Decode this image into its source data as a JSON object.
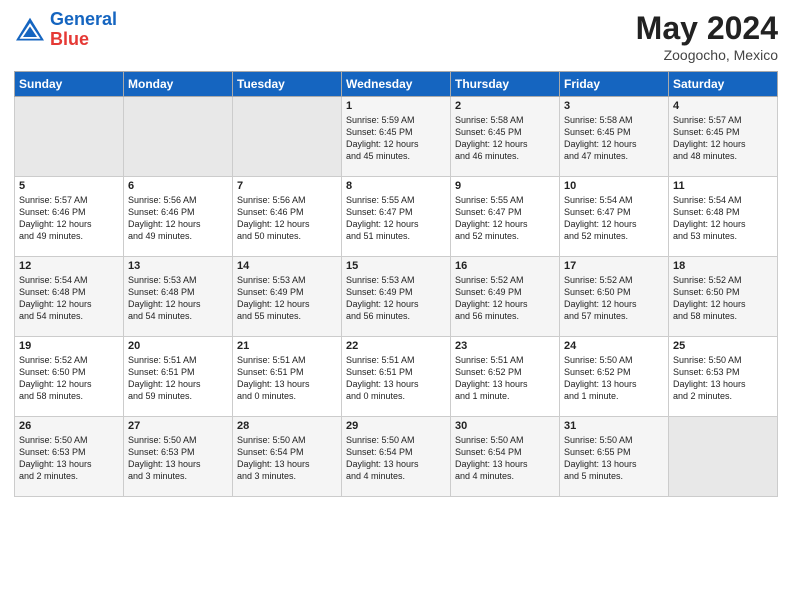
{
  "header": {
    "logo_line1": "General",
    "logo_line2": "Blue",
    "month": "May 2024",
    "location": "Zoogocho, Mexico"
  },
  "weekdays": [
    "Sunday",
    "Monday",
    "Tuesday",
    "Wednesday",
    "Thursday",
    "Friday",
    "Saturday"
  ],
  "weeks": [
    [
      {
        "day": "",
        "info": ""
      },
      {
        "day": "",
        "info": ""
      },
      {
        "day": "",
        "info": ""
      },
      {
        "day": "1",
        "info": "Sunrise: 5:59 AM\nSunset: 6:45 PM\nDaylight: 12 hours\nand 45 minutes."
      },
      {
        "day": "2",
        "info": "Sunrise: 5:58 AM\nSunset: 6:45 PM\nDaylight: 12 hours\nand 46 minutes."
      },
      {
        "day": "3",
        "info": "Sunrise: 5:58 AM\nSunset: 6:45 PM\nDaylight: 12 hours\nand 47 minutes."
      },
      {
        "day": "4",
        "info": "Sunrise: 5:57 AM\nSunset: 6:45 PM\nDaylight: 12 hours\nand 48 minutes."
      }
    ],
    [
      {
        "day": "5",
        "info": "Sunrise: 5:57 AM\nSunset: 6:46 PM\nDaylight: 12 hours\nand 49 minutes."
      },
      {
        "day": "6",
        "info": "Sunrise: 5:56 AM\nSunset: 6:46 PM\nDaylight: 12 hours\nand 49 minutes."
      },
      {
        "day": "7",
        "info": "Sunrise: 5:56 AM\nSunset: 6:46 PM\nDaylight: 12 hours\nand 50 minutes."
      },
      {
        "day": "8",
        "info": "Sunrise: 5:55 AM\nSunset: 6:47 PM\nDaylight: 12 hours\nand 51 minutes."
      },
      {
        "day": "9",
        "info": "Sunrise: 5:55 AM\nSunset: 6:47 PM\nDaylight: 12 hours\nand 52 minutes."
      },
      {
        "day": "10",
        "info": "Sunrise: 5:54 AM\nSunset: 6:47 PM\nDaylight: 12 hours\nand 52 minutes."
      },
      {
        "day": "11",
        "info": "Sunrise: 5:54 AM\nSunset: 6:48 PM\nDaylight: 12 hours\nand 53 minutes."
      }
    ],
    [
      {
        "day": "12",
        "info": "Sunrise: 5:54 AM\nSunset: 6:48 PM\nDaylight: 12 hours\nand 54 minutes."
      },
      {
        "day": "13",
        "info": "Sunrise: 5:53 AM\nSunset: 6:48 PM\nDaylight: 12 hours\nand 54 minutes."
      },
      {
        "day": "14",
        "info": "Sunrise: 5:53 AM\nSunset: 6:49 PM\nDaylight: 12 hours\nand 55 minutes."
      },
      {
        "day": "15",
        "info": "Sunrise: 5:53 AM\nSunset: 6:49 PM\nDaylight: 12 hours\nand 56 minutes."
      },
      {
        "day": "16",
        "info": "Sunrise: 5:52 AM\nSunset: 6:49 PM\nDaylight: 12 hours\nand 56 minutes."
      },
      {
        "day": "17",
        "info": "Sunrise: 5:52 AM\nSunset: 6:50 PM\nDaylight: 12 hours\nand 57 minutes."
      },
      {
        "day": "18",
        "info": "Sunrise: 5:52 AM\nSunset: 6:50 PM\nDaylight: 12 hours\nand 58 minutes."
      }
    ],
    [
      {
        "day": "19",
        "info": "Sunrise: 5:52 AM\nSunset: 6:50 PM\nDaylight: 12 hours\nand 58 minutes."
      },
      {
        "day": "20",
        "info": "Sunrise: 5:51 AM\nSunset: 6:51 PM\nDaylight: 12 hours\nand 59 minutes."
      },
      {
        "day": "21",
        "info": "Sunrise: 5:51 AM\nSunset: 6:51 PM\nDaylight: 13 hours\nand 0 minutes."
      },
      {
        "day": "22",
        "info": "Sunrise: 5:51 AM\nSunset: 6:51 PM\nDaylight: 13 hours\nand 0 minutes."
      },
      {
        "day": "23",
        "info": "Sunrise: 5:51 AM\nSunset: 6:52 PM\nDaylight: 13 hours\nand 1 minute."
      },
      {
        "day": "24",
        "info": "Sunrise: 5:50 AM\nSunset: 6:52 PM\nDaylight: 13 hours\nand 1 minute."
      },
      {
        "day": "25",
        "info": "Sunrise: 5:50 AM\nSunset: 6:53 PM\nDaylight: 13 hours\nand 2 minutes."
      }
    ],
    [
      {
        "day": "26",
        "info": "Sunrise: 5:50 AM\nSunset: 6:53 PM\nDaylight: 13 hours\nand 2 minutes."
      },
      {
        "day": "27",
        "info": "Sunrise: 5:50 AM\nSunset: 6:53 PM\nDaylight: 13 hours\nand 3 minutes."
      },
      {
        "day": "28",
        "info": "Sunrise: 5:50 AM\nSunset: 6:54 PM\nDaylight: 13 hours\nand 3 minutes."
      },
      {
        "day": "29",
        "info": "Sunrise: 5:50 AM\nSunset: 6:54 PM\nDaylight: 13 hours\nand 4 minutes."
      },
      {
        "day": "30",
        "info": "Sunrise: 5:50 AM\nSunset: 6:54 PM\nDaylight: 13 hours\nand 4 minutes."
      },
      {
        "day": "31",
        "info": "Sunrise: 5:50 AM\nSunset: 6:55 PM\nDaylight: 13 hours\nand 5 minutes."
      },
      {
        "day": "",
        "info": ""
      }
    ]
  ]
}
